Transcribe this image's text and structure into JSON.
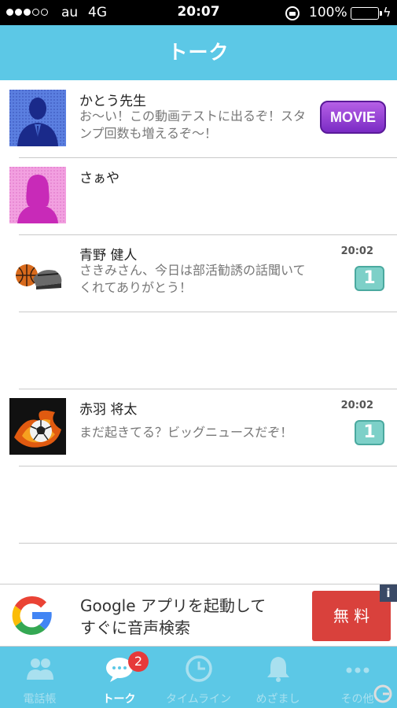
{
  "status_bar": {
    "carrier": "au",
    "network": "4G",
    "time": "20:07",
    "battery": "100%"
  },
  "header": {
    "title": "トーク"
  },
  "chats": [
    {
      "name": "かとう先生",
      "message": "お〜い！この動画テストに出るぞ！スタンプ回数も増えるぞ〜！",
      "time": "",
      "badge": "MOVIE"
    },
    {
      "name": "さぁや",
      "message": "",
      "time": "",
      "badge": ""
    },
    {
      "name": "青野 健人",
      "message": "さきみさん、今日は部活勧誘の話聞いてくれてありがとう！",
      "time": "20:02",
      "badge": "1"
    },
    {
      "name": "赤羽 将太",
      "message": "まだ起きてる？ビッグニュースだぞ！",
      "time": "20:02",
      "badge": "1"
    }
  ],
  "ad": {
    "line1": "Google アプリを起動して",
    "line2": "すぐに音声検索",
    "button": "無 料",
    "info": "i"
  },
  "tabs": [
    {
      "label": "電話帳",
      "icon": "contacts-icon"
    },
    {
      "label": "トーク",
      "icon": "chat-bubble-icon",
      "badge": "2"
    },
    {
      "label": "タイムライン",
      "icon": "clock-icon"
    },
    {
      "label": "めざまし",
      "icon": "bell-icon"
    },
    {
      "label": "その他",
      "icon": "more-icon"
    }
  ],
  "colors": {
    "header": "#5cc8e6",
    "unread_badge": "#7dd0c8",
    "movie_badge": "#8a35d0",
    "ad_button": "#d9413c",
    "tab_badge": "#e6393a"
  }
}
